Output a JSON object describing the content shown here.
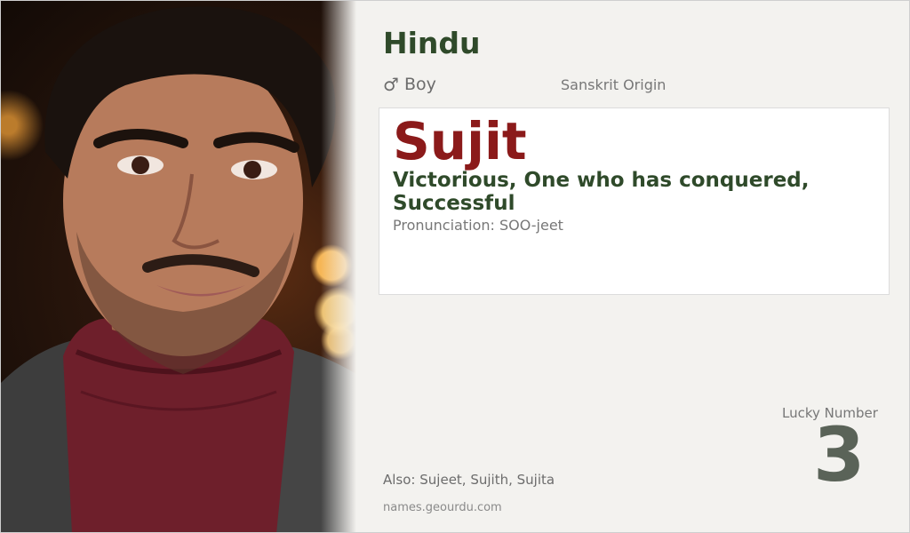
{
  "card": {
    "religion": "Hindu",
    "gender_icon": "♂",
    "gender_label": "Boy",
    "origin": "Sanskrit Origin",
    "name": "Sujit",
    "meaning": "Victorious, One who has conquered, Successful",
    "pronunciation_label": "Pronunciation:",
    "pronunciation_value": "SOO-jeet",
    "lucky_label": "Lucky Number",
    "lucky_number": "3",
    "also_label": "Also:",
    "also_values": "Sujeet, Sujith, Sujita",
    "website": "names.geourdu.com"
  },
  "colors": {
    "religion": "#2f4a2a",
    "name": "#8b1a1a",
    "meaning": "#2f4a2a",
    "lucky_number": "#5a6358"
  },
  "icons": {
    "gender": "male-symbol-icon"
  }
}
